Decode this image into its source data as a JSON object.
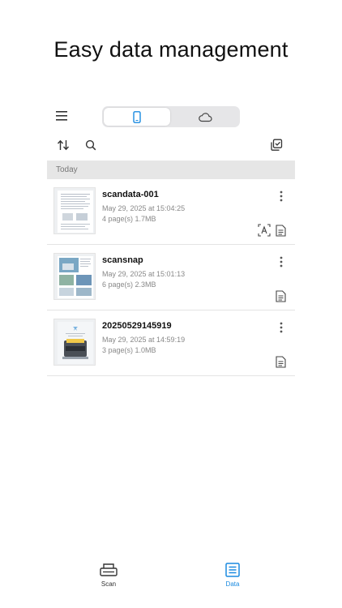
{
  "headline": "Easy data management",
  "toolbar": {
    "segments": [
      {
        "icon": "phone-icon",
        "active": true
      },
      {
        "icon": "cloud-icon",
        "active": false
      }
    ]
  },
  "section": {
    "header": "Today"
  },
  "items": [
    {
      "title": "scandata-001",
      "date": "May 29, 2025 at 15:04:25",
      "size": "4 page(s) 1.7MB",
      "badges": [
        "ocr-text-icon",
        "document-icon"
      ]
    },
    {
      "title": "scansnap",
      "date": "May 29, 2025 at 15:01:13",
      "size": "6 page(s) 2.3MB",
      "badges": [
        "document-icon"
      ]
    },
    {
      "title": "20250529145919",
      "date": "May 29, 2025 at 14:59:19",
      "size": "3 page(s) 1.0MB",
      "badges": [
        "document-icon"
      ]
    }
  ],
  "tabbar": {
    "scan_label": "Scan",
    "data_label": "Data"
  },
  "colors": {
    "accent": "#1a8ae0",
    "section_bg": "#e6e6e6",
    "segment_bg": "#e6e6e8"
  }
}
